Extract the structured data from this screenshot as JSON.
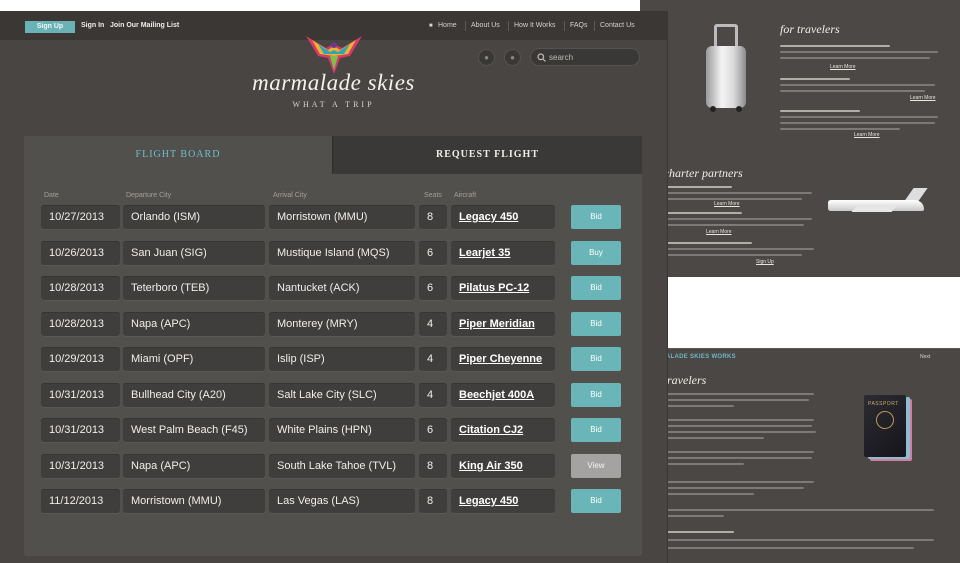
{
  "main": {
    "topbar": {
      "signup_label": "Sign Up",
      "signin_label": "Sign In",
      "mailing_label": "Join Our Mailing List",
      "nav": [
        "Home",
        "About Us",
        "How It Works",
        "FAQs",
        "Contact Us"
      ]
    },
    "brand": {
      "name": "marmalade skies",
      "tagline": "WHAT A TRIP"
    },
    "search": {
      "placeholder": "search"
    },
    "tabs": {
      "active": "FLIGHT BOARD",
      "inactive": "REQUEST FLIGHT"
    },
    "columns": [
      "Date",
      "Departure City",
      "Arrival City",
      "Seats",
      "Aircraft"
    ],
    "rows": [
      {
        "date": "10/27/2013",
        "departure": "Orlando (ISM)",
        "arrival": "Morristown (MMU)",
        "seats": "8",
        "aircraft": "Legacy 450",
        "action": "Bid"
      },
      {
        "date": "10/26/2013",
        "departure": "San Juan (SIG)",
        "arrival": "Mustique Island (MQS)",
        "seats": "6",
        "aircraft": "Learjet 35",
        "action": "Buy"
      },
      {
        "date": "10/28/2013",
        "departure": "Teterboro (TEB)",
        "arrival": "Nantucket (ACK)",
        "seats": "6",
        "aircraft": "Pilatus PC-12",
        "action": "Bid"
      },
      {
        "date": "10/28/2013",
        "departure": "Napa (APC)",
        "arrival": "Monterey (MRY)",
        "seats": "4",
        "aircraft": "Piper Meridian",
        "action": "Bid"
      },
      {
        "date": "10/29/2013",
        "departure": "Miami (OPF)",
        "arrival": "Islip (ISP)",
        "seats": "4",
        "aircraft": "Piper Cheyenne",
        "action": "Bid"
      },
      {
        "date": "10/31/2013",
        "departure": "Bullhead City (A20)",
        "arrival": "Salt Lake City (SLC)",
        "seats": "4",
        "aircraft": "Beechjet 400A",
        "action": "Bid"
      },
      {
        "date": "10/31/2013",
        "departure": "West Palm Beach (F45)",
        "arrival": "White Plains (HPN)",
        "seats": "6",
        "aircraft": "Citation CJ2",
        "action": "Bid"
      },
      {
        "date": "10/31/2013",
        "departure": "Napa (APC)",
        "arrival": "South Lake Tahoe (TVL)",
        "seats": "8",
        "aircraft": "King Air 350",
        "action": "View"
      },
      {
        "date": "11/12/2013",
        "departure": "Morristown (MMU)",
        "arrival": "Las Vegas (LAS)",
        "seats": "8",
        "aircraft": "Legacy 450",
        "action": "Bid"
      }
    ]
  },
  "panel_tr": {
    "title_travelers": "for travelers",
    "title_partners": "r charter partners",
    "links": [
      "Learn More",
      "Learn More",
      "Learn More",
      "Learn More",
      "Learn More",
      "Sign Up"
    ]
  },
  "panel_br": {
    "heading": "MARMALADE SKIES WORKS",
    "next": "Next",
    "title": "r travelers",
    "passport_word": "PASSPORT"
  },
  "colors": {
    "accent": "#6ab5b8",
    "bg": "#484543",
    "cell": "#403e3c",
    "view_button": "#a5a3a1"
  }
}
